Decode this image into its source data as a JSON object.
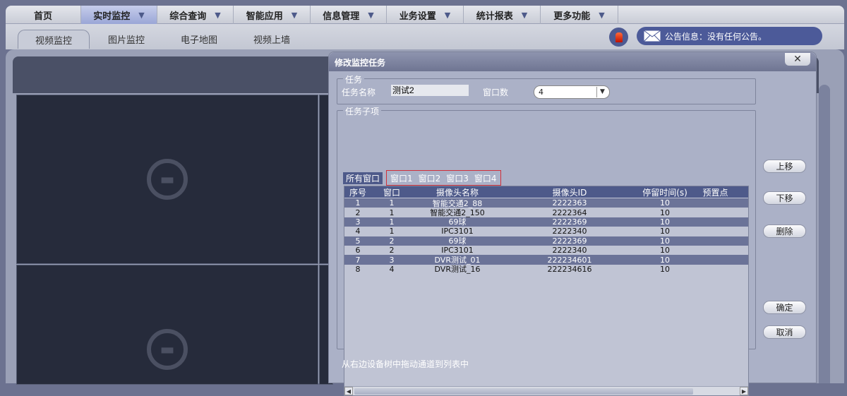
{
  "nav": {
    "items": [
      {
        "label": "首页",
        "dropdown": false
      },
      {
        "label": "实时监控",
        "dropdown": true,
        "active": true
      },
      {
        "label": "综合查询",
        "dropdown": true
      },
      {
        "label": "智能应用",
        "dropdown": true
      },
      {
        "label": "信息管理",
        "dropdown": true
      },
      {
        "label": "业务设置",
        "dropdown": true
      },
      {
        "label": "统计报表",
        "dropdown": true
      },
      {
        "label": "更多功能",
        "dropdown": true
      }
    ],
    "arrow": "▼"
  },
  "subtabs": [
    "视频监控",
    "图片监控",
    "电子地图",
    "视频上墙"
  ],
  "notice": {
    "text": "公告信息：没有任何公告。",
    "icon": "envelope-icon"
  },
  "dialog": {
    "title": "修改监控任务",
    "close": "✕",
    "task_group": "任务",
    "task_name_label": "任务名称",
    "task_name_value": "测试2",
    "window_count_label": "窗口数",
    "window_count_value": "4",
    "sub_group": "任务子项",
    "tabs": {
      "all": "所有窗口",
      "windows": [
        "窗口1",
        "窗口2",
        "窗口3",
        "窗口4"
      ]
    },
    "columns": [
      "序号",
      "窗口",
      "摄像头名称",
      "摄像头ID",
      "停留时间(s)",
      "预置点"
    ],
    "rows": [
      [
        "1",
        "1",
        "智能交通2_88",
        "2222363",
        "10",
        ""
      ],
      [
        "2",
        "1",
        "智能交通2_150",
        "2222364",
        "10",
        ""
      ],
      [
        "3",
        "1",
        "69球",
        "2222369",
        "10",
        ""
      ],
      [
        "4",
        "1",
        "IPC3101",
        "2222340",
        "10",
        ""
      ],
      [
        "5",
        "2",
        "69球",
        "2222369",
        "10",
        ""
      ],
      [
        "6",
        "2",
        "IPC3101",
        "2222340",
        "10",
        ""
      ],
      [
        "7",
        "3",
        "DVR测试_01",
        "222234601",
        "10",
        ""
      ],
      [
        "8",
        "4",
        "DVR测试_16",
        "222234616",
        "10",
        ""
      ]
    ],
    "buttons": {
      "up": "上移",
      "down": "下移",
      "delete": "删除",
      "ok": "确定",
      "cancel": "取消"
    },
    "hint": "从右边设备树中拖动通道到列表中"
  }
}
